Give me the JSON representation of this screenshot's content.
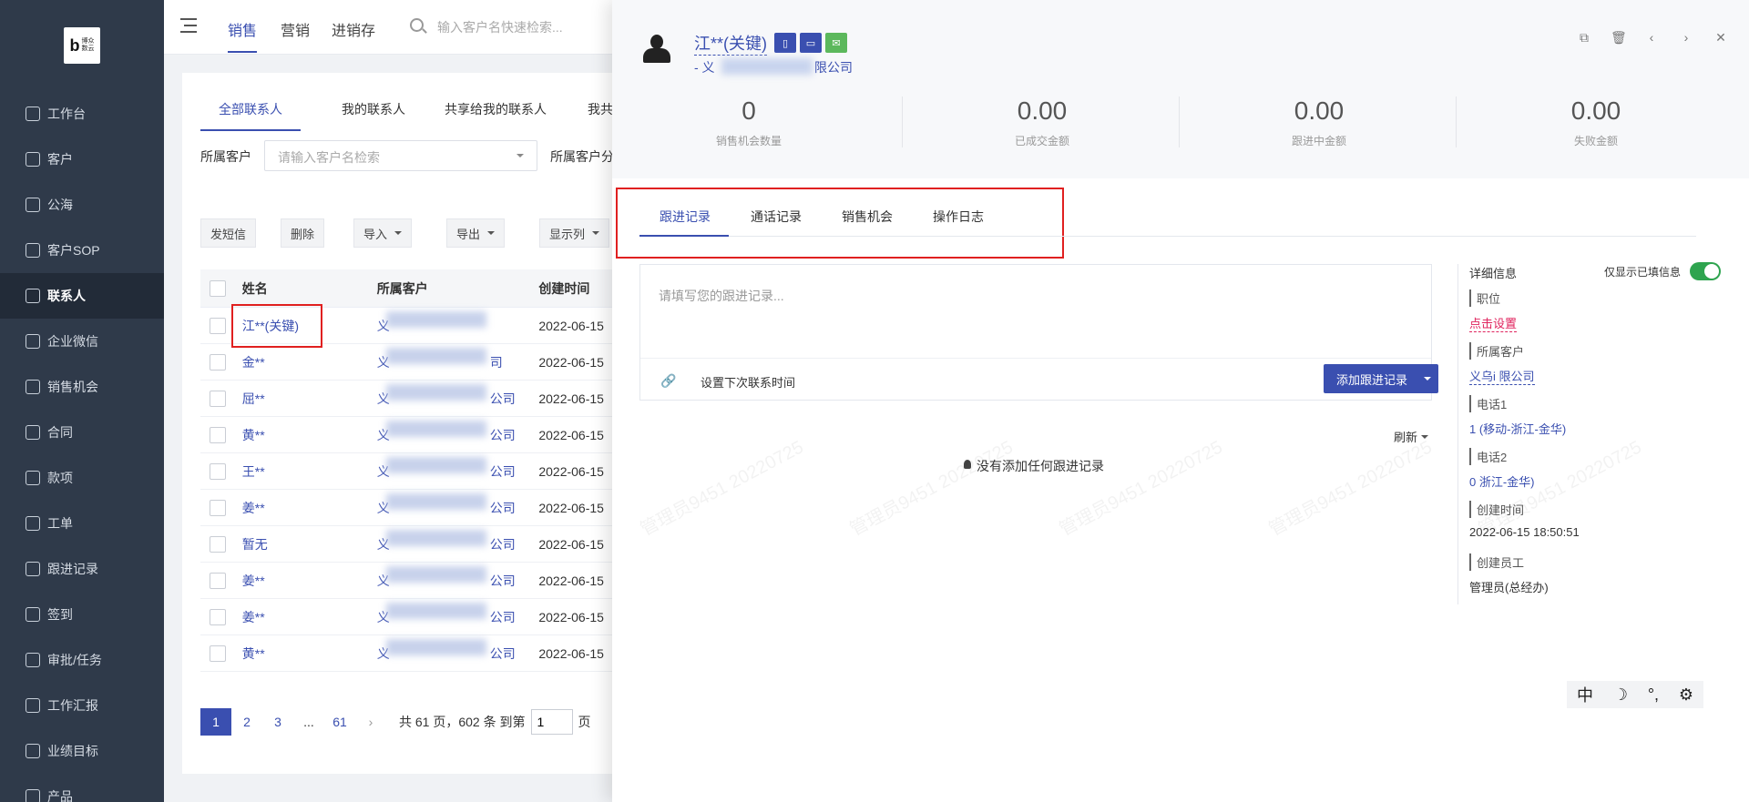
{
  "sidebar": {
    "logo_letter": "b",
    "logo_text": "博众\n数云",
    "items": [
      {
        "label": "工作台"
      },
      {
        "label": "客户"
      },
      {
        "label": "公海"
      },
      {
        "label": "客户SOP"
      },
      {
        "label": "联系人",
        "active": true
      },
      {
        "label": "企业微信"
      },
      {
        "label": "销售机会"
      },
      {
        "label": "合同"
      },
      {
        "label": "款项"
      },
      {
        "label": "工单"
      },
      {
        "label": "跟进记录"
      },
      {
        "label": "签到"
      },
      {
        "label": "审批/任务"
      },
      {
        "label": "工作汇报"
      },
      {
        "label": "业绩目标"
      },
      {
        "label": "产品"
      }
    ]
  },
  "topbar": {
    "tabs": [
      "销售",
      "营销",
      "进销存"
    ],
    "search_placeholder": "输入客户名快速检索..."
  },
  "content": {
    "sub_tabs": [
      "全部联系人",
      "我的联系人",
      "共享给我的联系人",
      "我共享的"
    ],
    "filter_label_1": "所属客户",
    "filter_placeholder": "请输入客户名检索",
    "filter_label_2": "所属客户分",
    "toolbar": {
      "sms": "发短信",
      "delete": "删除",
      "import": "导入",
      "export": "导出",
      "columns": "显示列"
    },
    "table": {
      "headers": [
        "姓名",
        "所属客户",
        "创建时间"
      ],
      "rows": [
        {
          "name": "江**(关键)",
          "customer": "义",
          "customer_suffix": "",
          "time": "2022-06-15"
        },
        {
          "name": "金**",
          "customer": "义",
          "customer_suffix": "司",
          "time": "2022-06-15"
        },
        {
          "name": "屈**",
          "customer": "义",
          "customer_suffix": "公司",
          "time": "2022-06-15"
        },
        {
          "name": "黄**",
          "customer": "义",
          "customer_suffix": "公司",
          "time": "2022-06-15"
        },
        {
          "name": "王**",
          "customer": "义",
          "customer_suffix": "公司",
          "time": "2022-06-15"
        },
        {
          "name": "姜**",
          "customer": "义",
          "customer_suffix": "公司",
          "time": "2022-06-15"
        },
        {
          "name": "暂无",
          "customer": "义",
          "customer_suffix": "公司",
          "time": "2022-06-15"
        },
        {
          "name": "姜**",
          "customer": "义",
          "customer_suffix": "公司",
          "time": "2022-06-15"
        },
        {
          "name": "姜**",
          "customer": "义",
          "customer_suffix": "公司",
          "time": "2022-06-15"
        },
        {
          "name": "黄**",
          "customer": "义",
          "customer_suffix": "公司",
          "time": "2022-06-15"
        }
      ]
    },
    "pager": {
      "pages": [
        "1",
        "2",
        "3",
        "...",
        "61"
      ],
      "info": "共 61 页，602 条 到第",
      "goto_value": "1",
      "page_suffix": "页"
    }
  },
  "drawer": {
    "contact_name": "江**(关键)",
    "company_prefix": "- 义",
    "company_suffix": "限公司",
    "stats": [
      {
        "value": "0",
        "label": "销售机会数量"
      },
      {
        "value": "0.00",
        "label": "已成交金额"
      },
      {
        "value": "0.00",
        "label": "跟进中金额"
      },
      {
        "value": "0.00",
        "label": "失败金额"
      }
    ],
    "tabs": [
      "跟进记录",
      "通话记录",
      "销售机会",
      "操作日志"
    ],
    "editor_placeholder": "请填写您的跟进记录...",
    "next_contact": "设置下次联系时间",
    "add_button": "添加跟进记录",
    "refresh": "刷新",
    "empty_text": "没有添加任何跟进记录",
    "detail": {
      "title": "详细信息",
      "only_filled": "仅显示已填信息",
      "fields": [
        {
          "label": "职位",
          "value": "点击设置"
        },
        {
          "label": "所属客户",
          "value": "义乌i              限公司"
        },
        {
          "label": "电话1",
          "value": "1               (移动-浙江-金华)"
        },
        {
          "label": "电话2",
          "value": "0               浙江-金华)"
        },
        {
          "label": "创建时间",
          "value": "2022-06-15 18:50:51"
        },
        {
          "label": "创建员工",
          "value": "管理员(总经办)"
        }
      ]
    },
    "ime": [
      "中",
      "☽",
      "°,",
      "⚙"
    ],
    "watermark": "管理员9451 20220725"
  }
}
